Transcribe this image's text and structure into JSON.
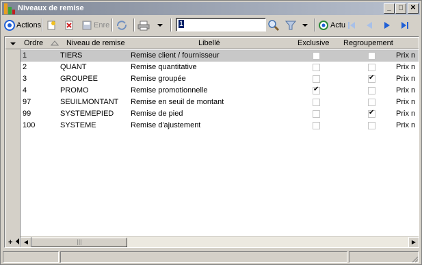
{
  "window": {
    "title": "Niveaux de remise"
  },
  "toolbar": {
    "actions_label": "Actions",
    "save_label": "Enre",
    "search_value": "1",
    "refresh_label": "Actu"
  },
  "columns": {
    "ordre": "Ordre",
    "niveau": "Niveau de remise",
    "libelle": "Libellé",
    "exclusive": "Exclusive",
    "regroupement": "Regroupement",
    "prix": ""
  },
  "rows": [
    {
      "ordre": "1",
      "niveau": "TIERS",
      "libelle": "Remise client / fournisseur",
      "exclusive": false,
      "regroupement": false,
      "prix": "Prix n"
    },
    {
      "ordre": "2",
      "niveau": "QUANT",
      "libelle": "Remise quantitative",
      "exclusive": false,
      "regroupement": false,
      "prix": "Prix n"
    },
    {
      "ordre": "3",
      "niveau": "GROUPEE",
      "libelle": "Remise groupée",
      "exclusive": false,
      "regroupement": true,
      "prix": "Prix n"
    },
    {
      "ordre": "4",
      "niveau": "PROMO",
      "libelle": "Remise promotionnelle",
      "exclusive": true,
      "regroupement": false,
      "prix": "Prix n"
    },
    {
      "ordre": "97",
      "niveau": "SEUILMONTANT",
      "libelle": "Remise en seuil de montant",
      "exclusive": false,
      "regroupement": false,
      "prix": "Prix n"
    },
    {
      "ordre": "99",
      "niveau": "SYSTEMEPIED",
      "libelle": "Remise de pied",
      "exclusive": false,
      "regroupement": true,
      "prix": "Prix n"
    },
    {
      "ordre": "100",
      "niveau": "SYSTEME",
      "libelle": "Remise d'ajustement",
      "exclusive": false,
      "regroupement": false,
      "prix": "Prix n"
    }
  ],
  "grid": {
    "add_row_symbol": "+"
  },
  "icons": {
    "actions": "circle-target-icon",
    "new": "new-document-icon",
    "delete": "delete-icon",
    "save": "save-icon",
    "sync": "sync-icon",
    "print": "printer-icon",
    "search": "magnifier-icon",
    "filter": "funnel-icon",
    "refresh": "refresh-icon",
    "first": "first-record-icon",
    "prev": "previous-record-icon",
    "next": "next-record-icon",
    "last": "last-record-icon"
  },
  "colors": {
    "title_gradient_start": "#7f8796",
    "title_gradient_end": "#b9c1cf",
    "selected_row": "#c8c8c8",
    "nav_blue": "#1f5fd6"
  }
}
